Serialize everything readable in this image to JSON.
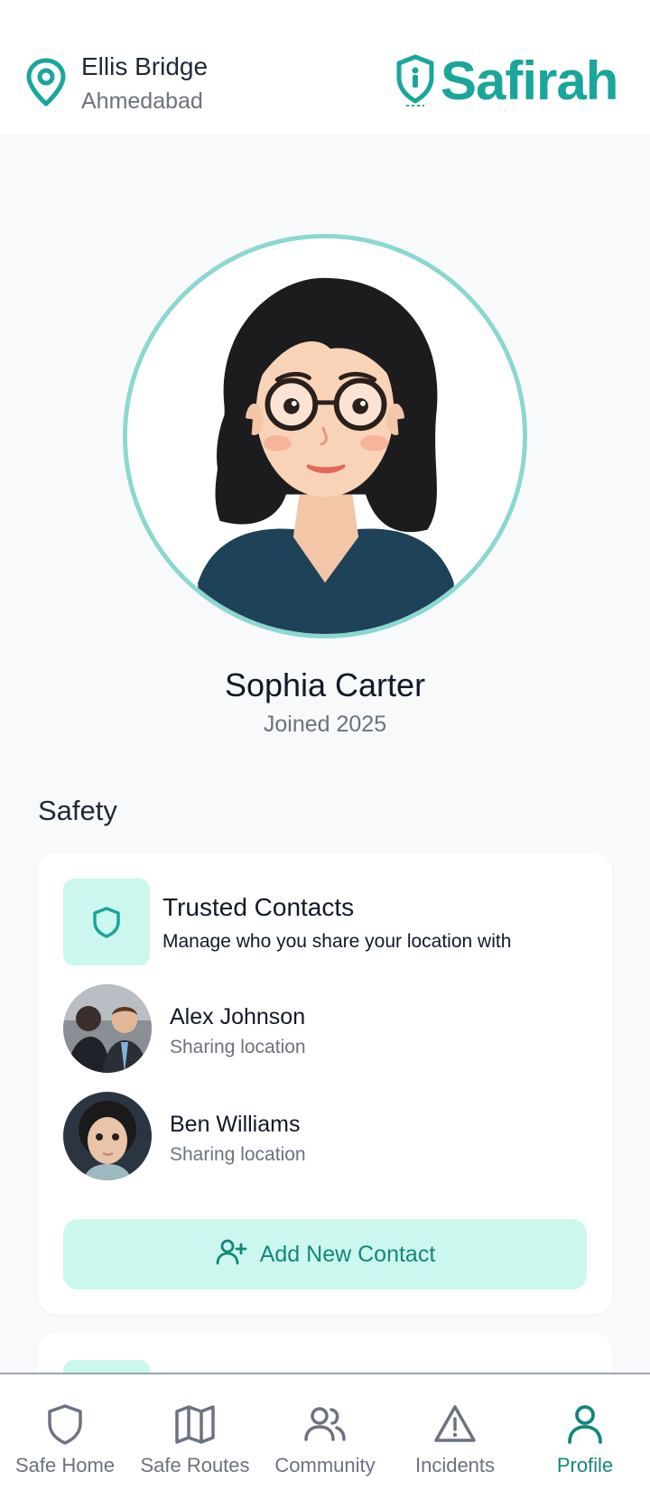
{
  "header": {
    "location_title": "Ellis Bridge",
    "location_subtitle": "Ahmedabad",
    "logo_text": "Safirah",
    "brand_color": "#1aa69a"
  },
  "profile": {
    "name": "Sophia Carter",
    "joined": "Joined 2025"
  },
  "safety": {
    "section_title": "Safety",
    "trusted_contacts": {
      "title": "Trusted Contacts",
      "description": "Manage who you share your location with",
      "icon": "shield-icon",
      "contacts": [
        {
          "name": "Alex Johnson",
          "status": "Sharing location"
        },
        {
          "name": "Ben Williams",
          "status": "Sharing location"
        }
      ],
      "add_button_label": "Add New Contact",
      "add_button_icon": "user-plus-icon"
    }
  },
  "bottom_nav": {
    "items": [
      {
        "label": "Safe Home",
        "icon": "shield-icon",
        "active": false
      },
      {
        "label": "Safe Routes",
        "icon": "map-icon",
        "active": false
      },
      {
        "label": "Community",
        "icon": "users-icon",
        "active": false
      },
      {
        "label": "Incidents",
        "icon": "alert-triangle-icon",
        "active": false
      },
      {
        "label": "Profile",
        "icon": "user-icon",
        "active": true
      }
    ],
    "active_color": "#14877b",
    "inactive_color": "#6b7280"
  }
}
